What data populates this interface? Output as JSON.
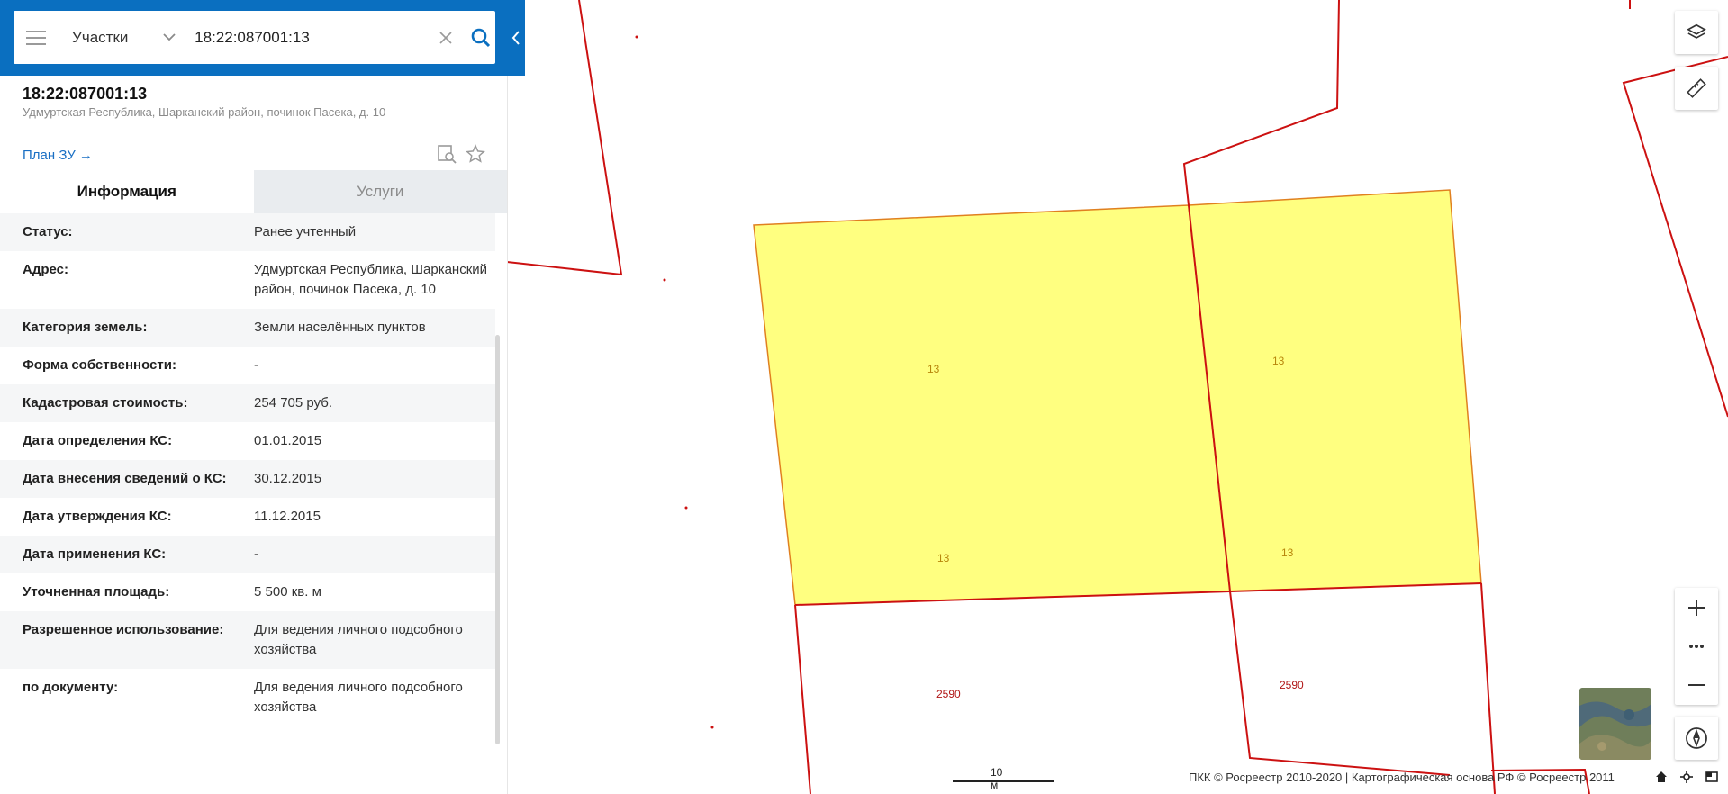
{
  "search": {
    "type_label": "Участки",
    "query": "18:22:087001:13"
  },
  "object": {
    "title": "18:22:087001:13",
    "address_short": "Удмуртская Республика, Шарканский район, починок Пасека, д. 10",
    "plan_link": "План ЗУ →"
  },
  "tabs": [
    {
      "label": "Информация",
      "active": true
    },
    {
      "label": "Услуги",
      "active": false
    }
  ],
  "info_rows": [
    {
      "key": "Статус:",
      "value": "Ранее учтенный"
    },
    {
      "key": "Адрес:",
      "value": "Удмуртская Республика, Шарканский район, починок Пасека, д. 10"
    },
    {
      "key": "Категория земель:",
      "value": "Земли населённых пунктов"
    },
    {
      "key": "Форма собственности:",
      "value": "-"
    },
    {
      "key": "Кадастровая стоимость:",
      "value": "254 705 руб."
    },
    {
      "key": "Дата определения КС:",
      "value": "01.01.2015"
    },
    {
      "key": "Дата внесения сведений о КС:",
      "value": "30.12.2015"
    },
    {
      "key": "Дата утверждения КС:",
      "value": "11.12.2015"
    },
    {
      "key": "Дата применения КС:",
      "value": "-"
    },
    {
      "key": "Уточненная площадь:",
      "value": "5 500 кв. м"
    },
    {
      "key": "Разрешенное использование:",
      "value": "Для ведения личного подсобного хозяйства"
    },
    {
      "key": "по документу:",
      "value": "Для ведения личного подсобного хозяйства"
    }
  ],
  "map": {
    "parcel_labels": [
      "13",
      "13",
      "13",
      "13",
      "2590",
      "2590"
    ],
    "scale_label": "10 м",
    "copyright": "ПКК © Росреестр 2010-2020 | Картографическая основа РФ © Росреестр 2011",
    "colors": {
      "boundary": "#cc1111",
      "selected_fill": "#ffff80",
      "selected_stroke": "#e08020",
      "accent": "#0a6fc0"
    }
  },
  "icons": [
    "menu-icon",
    "chevron-down-icon",
    "clear-icon",
    "search-icon",
    "collapse-panel-icon",
    "find-on-map-icon",
    "star-icon",
    "layers-icon",
    "ruler-icon",
    "zoom-in-icon",
    "more-icon",
    "zoom-out-icon",
    "compass-icon",
    "home-icon",
    "locate-icon",
    "fullscreen-icon"
  ]
}
